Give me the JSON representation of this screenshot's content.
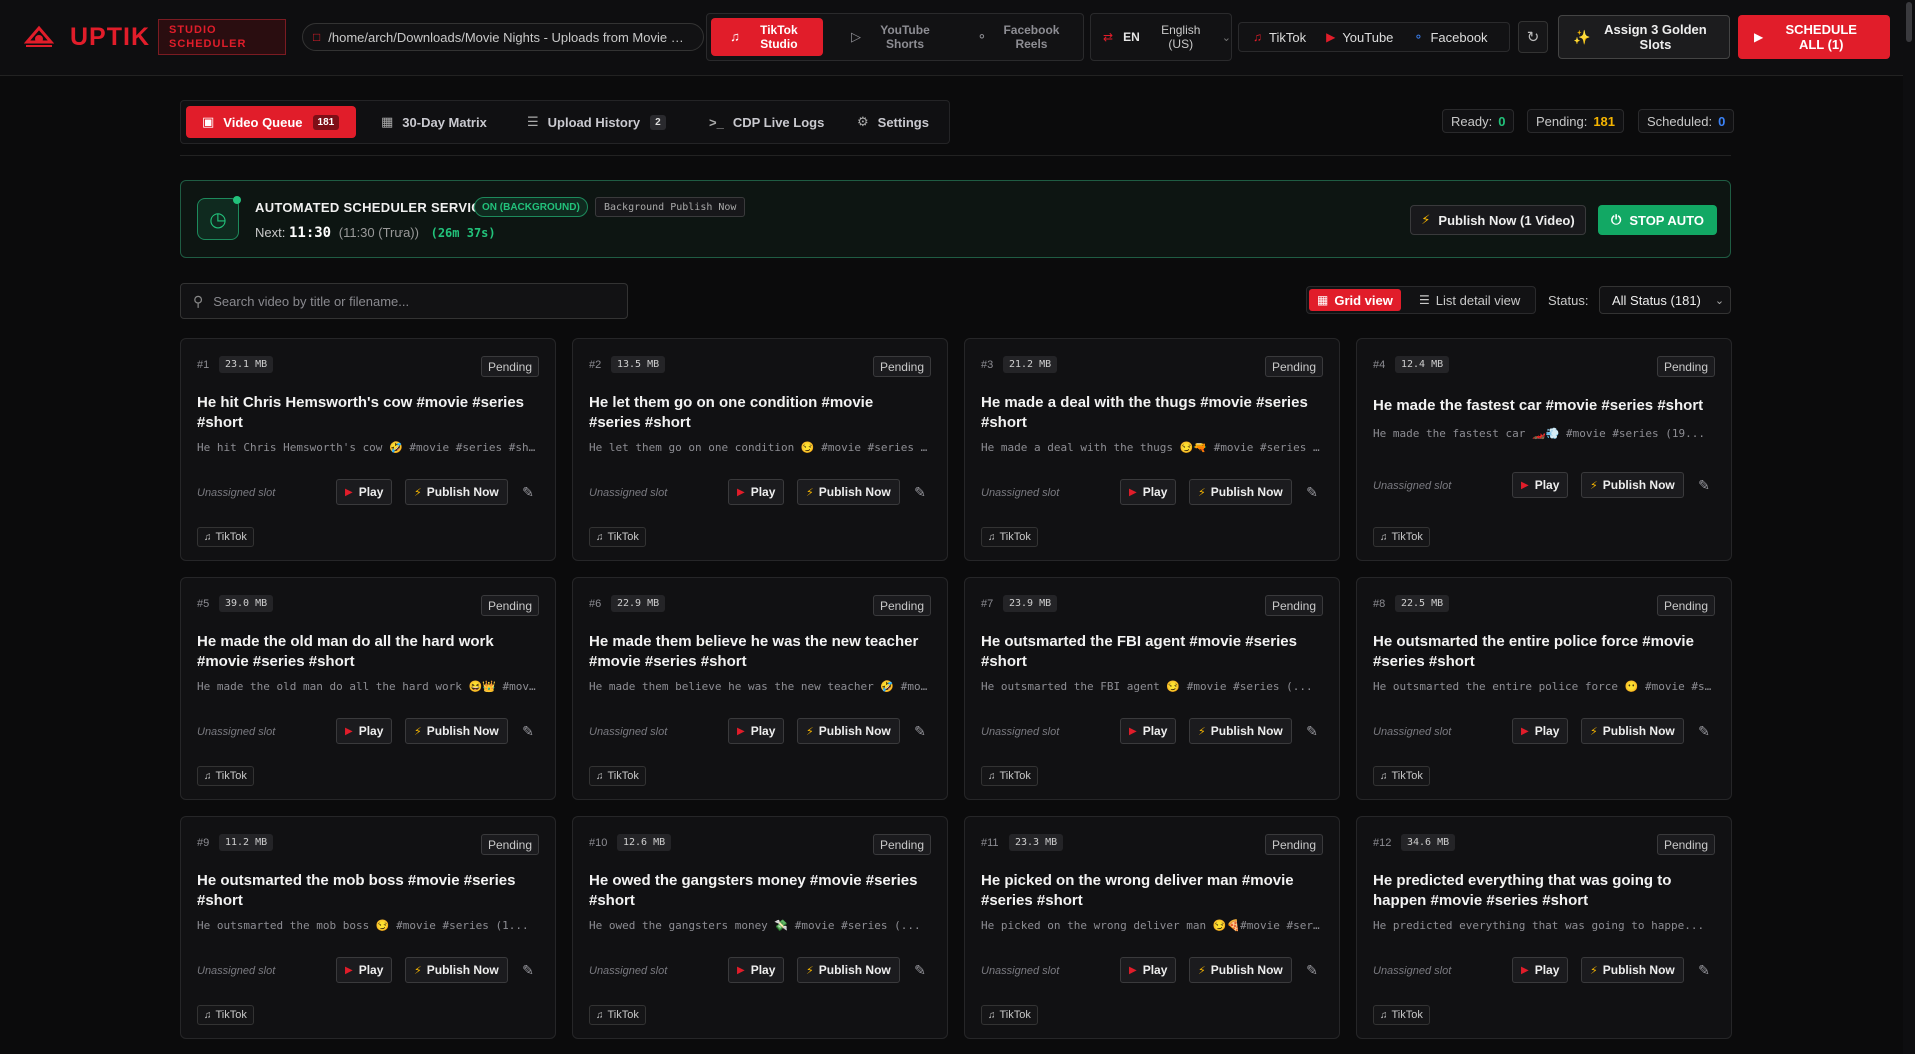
{
  "header": {
    "logo_text": "UPTIK",
    "studio_badge": "STUDIO SCHEDULER",
    "folder_path": "/home/arch/Downloads/Movie Nights - Uploads from Movie Ni...",
    "modes": [
      {
        "label": "TikTok Studio",
        "icon": "tiktok-icon",
        "active": true
      },
      {
        "label": "YouTube Shorts",
        "icon": "youtube-icon",
        "active": false
      },
      {
        "label": "Facebook Reels",
        "icon": "share-icon",
        "active": false
      }
    ],
    "language": {
      "code": "EN",
      "name": "English (US)"
    },
    "platform_links": [
      {
        "label": "TikTok",
        "icon": "tiktok-icon",
        "color": "#e11d2a"
      },
      {
        "label": "YouTube",
        "icon": "youtube-icon",
        "color": "#e11d2a"
      },
      {
        "label": "Facebook",
        "icon": "share-icon",
        "color": "#3b82f6"
      }
    ],
    "golden_slots_label": "Assign 3 Golden Slots",
    "schedule_all_label": "SCHEDULE ALL (1)"
  },
  "tabs": [
    {
      "label": "Video Queue",
      "count": "181",
      "icon": "video-icon",
      "active": true
    },
    {
      "label": "30-Day Matrix",
      "count": "",
      "icon": "calendar-icon",
      "active": false
    },
    {
      "label": "Upload History",
      "count": "2",
      "icon": "layers-icon",
      "active": false
    },
    {
      "label": "CDP Live Logs",
      "count": "",
      "icon": "terminal-icon",
      "active": false
    },
    {
      "label": "Settings",
      "count": "",
      "icon": "gear-icon",
      "active": false
    }
  ],
  "stats": {
    "ready_label": "Ready:",
    "ready": "0",
    "ready_color": "#22c27b",
    "pending_label": "Pending:",
    "pending": "181",
    "pending_color": "#f5b400",
    "scheduled_label": "Scheduled:",
    "scheduled": "0",
    "scheduled_color": "#3b82f6"
  },
  "scheduler": {
    "title": "AUTOMATED SCHEDULER SERVICE",
    "status_badge": "ON (BACKGROUND)",
    "bg_badge": "Background Publish Now",
    "next_label": "Next:",
    "next_time": "11:30",
    "next_local": "(11:30 (Trưa))",
    "countdown": "(26m 37s)",
    "publish_now_label": "Publish Now (1 Video)",
    "stop_label": "STOP AUTO"
  },
  "search": {
    "placeholder": "Search video by title or filename..."
  },
  "view": {
    "grid_label": "Grid view",
    "list_label": "List detail view",
    "status_label": "Status:",
    "status_value": "All Status (181)"
  },
  "card_labels": {
    "slot": "Unassigned slot",
    "play": "Play",
    "publish": "Publish Now",
    "platform": "TikTok"
  },
  "videos": [
    {
      "num": "#1",
      "size": "23.1 MB",
      "status": "Pending",
      "title": "He hit Chris Hemsworth's cow #movie #series #short",
      "desc": "He hit Chris Hemsworth's cow 🤣 #movie #series #short"
    },
    {
      "num": "#2",
      "size": "13.5 MB",
      "status": "Pending",
      "title": "He let them go on one condition #movie #series #short",
      "desc": "He let them go on one condition 😏 #movie #series #short"
    },
    {
      "num": "#3",
      "size": "21.2 MB",
      "status": "Pending",
      "title": "He made a deal with the thugs #movie #series #short",
      "desc": "He made a deal with the thugs 😏🔫 #movie #series #short"
    },
    {
      "num": "#4",
      "size": "12.4 MB",
      "status": "Pending",
      "title": "He made the fastest car #movie #series #short",
      "desc": "He made the fastest car 🏎️💨 #movie #series (19...",
      "single": true
    },
    {
      "num": "#5",
      "size": "39.0 MB",
      "status": "Pending",
      "title": "He made the old man do all the hard work #movie #series #short",
      "desc": "He made the old man do all the hard work 😆👑 #movie #series"
    },
    {
      "num": "#6",
      "size": "22.9 MB",
      "status": "Pending",
      "title": "He made them believe he was the new teacher #movie #series #short",
      "desc": "He made them believe he was the new teacher 🤣 #movie"
    },
    {
      "num": "#7",
      "size": "23.9 MB",
      "status": "Pending",
      "title": "He outsmarted the FBI agent #movie #series #short",
      "desc": "He outsmarted the FBI agent 😏 #movie #series (..."
    },
    {
      "num": "#8",
      "size": "22.5 MB",
      "status": "Pending",
      "title": "He outsmarted the entire police force #movie #series #short",
      "desc": "He outsmarted the entire police force 😶 #movie #series"
    },
    {
      "num": "#9",
      "size": "11.2 MB",
      "status": "Pending",
      "title": "He outsmarted the mob boss #movie #series #short",
      "desc": "He outsmarted the mob boss 😏 #movie #series (1..."
    },
    {
      "num": "#10",
      "size": "12.6 MB",
      "status": "Pending",
      "title": "He owed the gangsters money #movie #series #short",
      "desc": "He owed the gangsters money 💸 #movie #series (..."
    },
    {
      "num": "#11",
      "size": "23.3 MB",
      "status": "Pending",
      "title": "He picked on the wrong deliver man #movie #series #short",
      "desc": "He picked on the wrong deliver man 😏🍕#movie #series"
    },
    {
      "num": "#12",
      "size": "34.6 MB",
      "status": "Pending",
      "title": "He predicted everything that was going to happen #movie #series #short",
      "desc": "He predicted everything that was going to happe..."
    }
  ]
}
